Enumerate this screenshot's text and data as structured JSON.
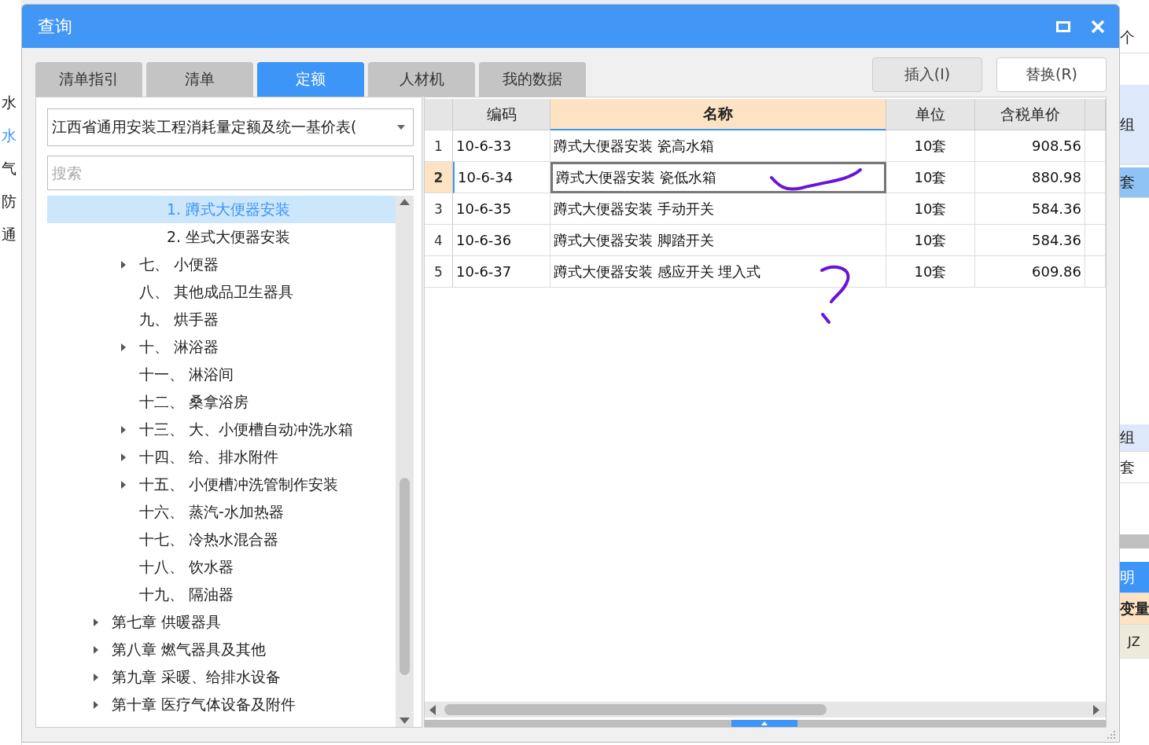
{
  "background": {
    "left_items": [
      {
        "label": "水",
        "selected": false
      },
      {
        "label": "水",
        "selected": true
      },
      {
        "label": "气",
        "selected": false
      },
      {
        "label": "防",
        "selected": false
      },
      {
        "label": "通",
        "selected": false
      }
    ],
    "right_items": [
      {
        "label": "个",
        "kind": "cell"
      },
      {
        "label": "组",
        "kind": "group"
      },
      {
        "label": "套",
        "kind": "current"
      },
      {
        "label": "组",
        "kind": "group"
      },
      {
        "label": "套",
        "kind": "cell"
      },
      {
        "label": "明",
        "kind": "tab"
      },
      {
        "label": "变量",
        "kind": "header"
      },
      {
        "label": "JZ",
        "kind": "code"
      }
    ]
  },
  "window": {
    "title": "查询"
  },
  "tabs": [
    {
      "label": "清单指引",
      "selected": false
    },
    {
      "label": "清单",
      "selected": false
    },
    {
      "label": "定额",
      "selected": true
    },
    {
      "label": "人材机",
      "selected": false
    },
    {
      "label": "我的数据",
      "selected": false
    }
  ],
  "buttons": [
    {
      "label": "插入(I)",
      "highlighted": false
    },
    {
      "label": "替换(R)",
      "highlighted": true
    }
  ],
  "library_select": {
    "value": "江西省通用安装工程消耗量定额及统一基价表("
  },
  "search": {
    "placeholder": "搜索"
  },
  "tree": {
    "items": [
      {
        "children": [
          {
            "children": [
              {
                "label": "1. 蹲式大便器安装",
                "selected": true,
                "expandable": false
              },
              {
                "label": "2. 坐式大便器安装",
                "selected": false,
                "expandable": false
              }
            ]
          },
          {
            "label": "七、 小便器",
            "selected": false,
            "expandable": true
          },
          {
            "label": "八、 其他成品卫生器具",
            "selected": false,
            "expandable": false
          },
          {
            "label": "九、 烘手器",
            "selected": false,
            "expandable": false
          },
          {
            "label": "十、 淋浴器",
            "selected": false,
            "expandable": true
          },
          {
            "label": "十一、 淋浴间",
            "selected": false,
            "expandable": false
          },
          {
            "label": "十二、 桑拿浴房",
            "selected": false,
            "expandable": false
          },
          {
            "label": "十三、 大、小便槽自动冲洗水箱",
            "selected": false,
            "expandable": true
          },
          {
            "label": "十四、 给、排水附件",
            "selected": false,
            "expandable": true
          },
          {
            "label": "十五、 小便槽冲洗管制作安装",
            "selected": false,
            "expandable": true
          },
          {
            "label": "十六、 蒸汽-水加热器",
            "selected": false,
            "expandable": false
          },
          {
            "label": "十七、 冷热水混合器",
            "selected": false,
            "expandable": false
          },
          {
            "label": "十八、 饮水器",
            "selected": false,
            "expandable": false
          },
          {
            "label": "十九、 隔油器",
            "selected": false,
            "expandable": false
          }
        ]
      },
      {
        "label": "第七章 供暖器具",
        "selected": false,
        "expandable": true
      },
      {
        "label": "第八章 燃气器具及其他",
        "selected": false,
        "expandable": true
      },
      {
        "label": "第九章 采暖、给排水设备",
        "selected": false,
        "expandable": true
      },
      {
        "label": "第十章 医疗气体设备及附件",
        "selected": false,
        "expandable": true
      }
    ]
  },
  "table": {
    "columns": [
      {
        "label": "编码",
        "selected": false
      },
      {
        "label": "名称",
        "selected": true
      },
      {
        "label": "单位",
        "selected": false
      },
      {
        "label": "含税单价",
        "selected": false
      }
    ],
    "rows": [
      {
        "index": "1",
        "selected": false,
        "cells": [
          "10-6-33",
          "蹲式大便器安装  瓷高水箱",
          "10套",
          "908.56"
        ]
      },
      {
        "index": "2",
        "selected": true,
        "cells": [
          "10-6-34",
          "蹲式大便器安装  瓷低水箱",
          "10套",
          "880.98"
        ]
      },
      {
        "index": "3",
        "selected": false,
        "cells": [
          "10-6-35",
          "蹲式大便器安装  手动开关",
          "10套",
          "584.36"
        ]
      },
      {
        "index": "4",
        "selected": false,
        "cells": [
          "10-6-36",
          "蹲式大便器安装  脚踏开关",
          "10套",
          "584.36"
        ]
      },
      {
        "index": "5",
        "selected": false,
        "cells": [
          "10-6-37",
          "蹲式大便器安装  感应开关  埋入式",
          "10套",
          "609.86"
        ]
      }
    ]
  }
}
